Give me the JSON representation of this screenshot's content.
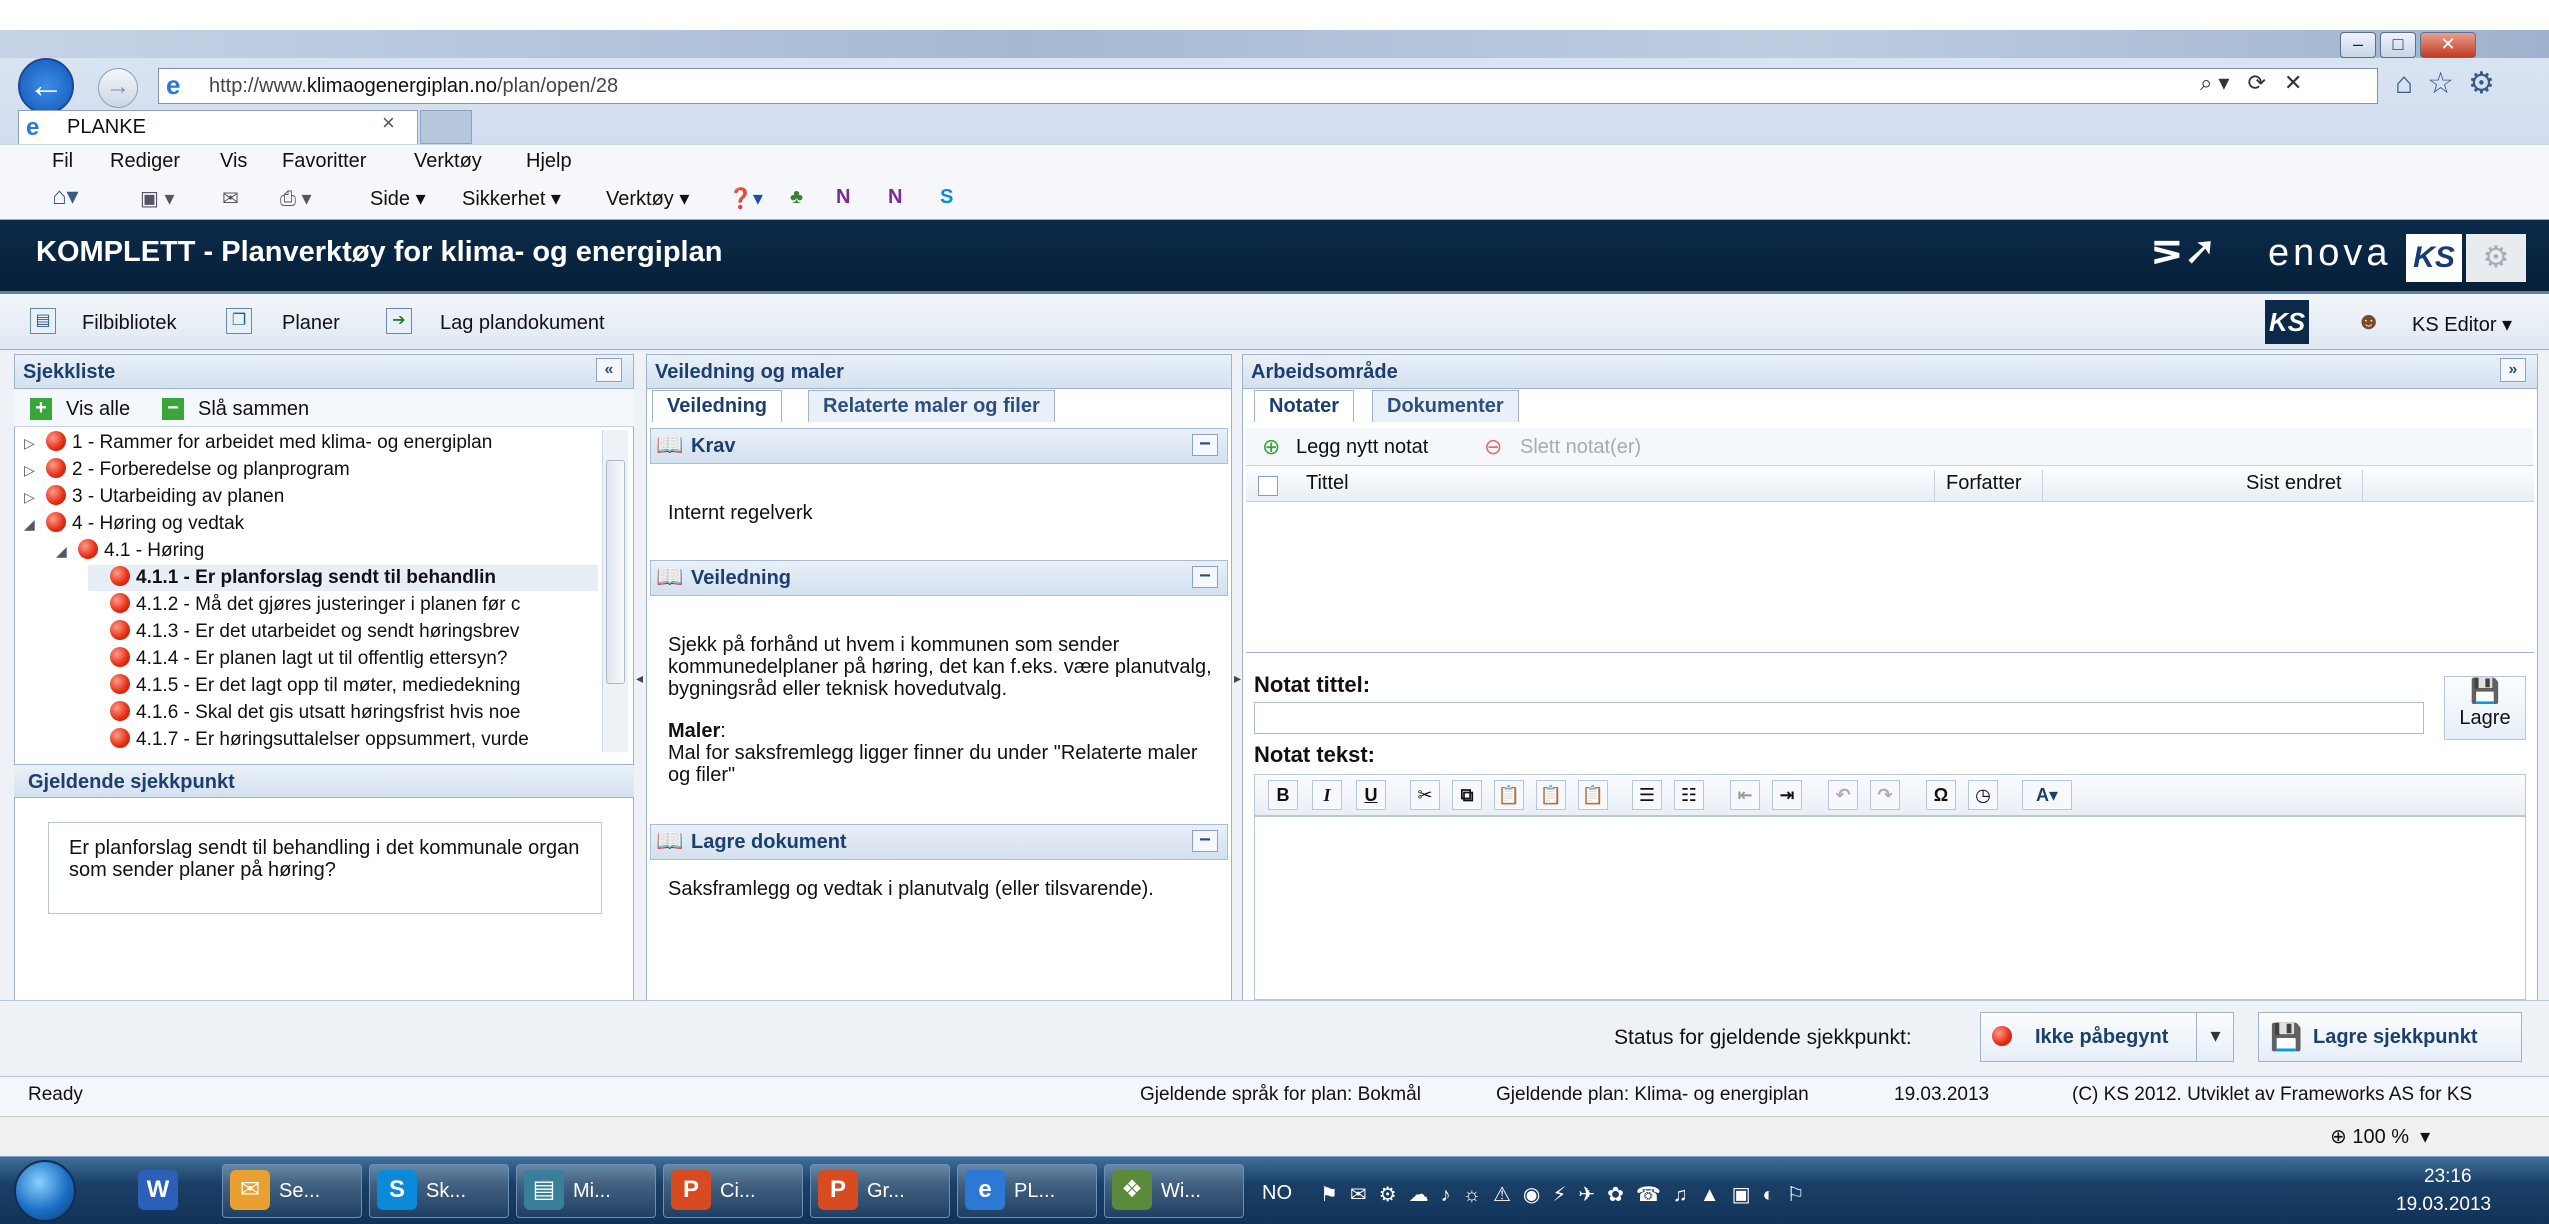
{
  "browser": {
    "url_prefix": "http://www.",
    "url_domain": "klimaogenergiplan.no",
    "url_path": "/plan/open/28",
    "tab_title": "PLANKE",
    "tab_close": "×",
    "menus": [
      "Fil",
      "Rediger",
      "Vis",
      "Favoritter",
      "Verktøy",
      "Hjelp"
    ],
    "commands": [
      "Side ▾",
      "Sikkerhet ▾",
      "Verktøy ▾"
    ],
    "zoom": "100 %"
  },
  "app": {
    "title": "KOMPLETT - Planverktøy for klima- og energiplan",
    "enova": "enova",
    "ks": "KS",
    "toolbar": [
      "Filbibliotek",
      "Planer",
      "Lag plandokument"
    ],
    "user": "KS Editor ▾"
  },
  "checklist": {
    "title": "Sjekkliste",
    "show_all": "Vis alle",
    "merge": "Slå sammen",
    "items": [
      {
        "label": "1 - Rammer for arbeidet med klima- og energiplan",
        "level": 0,
        "toggle": "▷"
      },
      {
        "label": "2 - Forberedelse og planprogram",
        "level": 0,
        "toggle": "▷"
      },
      {
        "label": "3 - Utarbeiding av planen",
        "level": 0,
        "toggle": "▷"
      },
      {
        "label": "4 - Høring og vedtak",
        "level": 0,
        "toggle": "◢"
      },
      {
        "label": "4.1 - Høring",
        "level": 1,
        "toggle": "◢"
      },
      {
        "label": "4.1.1 - Er planforslag sendt til behandlin",
        "level": 2,
        "toggle": "",
        "bold": true
      },
      {
        "label": "4.1.2 - Må det gjøres justeringer i planen før c",
        "level": 2,
        "toggle": ""
      },
      {
        "label": "4.1.3 - Er det utarbeidet og sendt høringsbrev",
        "level": 2,
        "toggle": ""
      },
      {
        "label": "4.1.4 - Er planen lagt ut til offentlig ettersyn?",
        "level": 2,
        "toggle": ""
      },
      {
        "label": "4.1.5 - Er det lagt opp til møter, mediedekning",
        "level": 2,
        "toggle": ""
      },
      {
        "label": "4.1.6 - Skal det gis utsatt høringsfrist hvis noe",
        "level": 2,
        "toggle": ""
      },
      {
        "label": "4.1.7 - Er høringsuttalelser oppsummert, vurde",
        "level": 2,
        "toggle": ""
      }
    ],
    "current_title": "Gjeldende sjekkpunkt",
    "current_text": "Er planforslag sendt til behandling i det kommunale organ som sender planer på høring?"
  },
  "guidance": {
    "title": "Veiledning og maler",
    "tabs": [
      "Veiledning",
      "Relaterte maler og filer"
    ],
    "krav_title": "Krav",
    "krav_text": "Internt regelverk",
    "veil_title": "Veiledning",
    "veil_text": "Sjekk på forhånd ut hvem i kommunen som sender kommunedelplaner på høring, det kan f.eks. være planutvalg, bygningsråd eller teknisk hovedutvalg.",
    "maler_label": "Maler",
    "maler_colon": ":",
    "maler_text": "Mal for saksfremlegg ligger finner du under \"Relaterte maler og filer\"",
    "lagre_title": "Lagre dokument",
    "lagre_text": "Saksframlegg og vedtak i planutvalg (eller tilsvarende)."
  },
  "workspace": {
    "title": "Arbeidsområde",
    "tabs": [
      "Notater",
      "Dokumenter"
    ],
    "new_note": "Legg nytt notat",
    "delete_note": "Slett notat(er)",
    "columns": [
      "Tittel",
      "Forfatter",
      "Sist endret"
    ],
    "note_title_label": "Notat tittel:",
    "note_title_value": "",
    "save": "Lagre",
    "note_text_label": "Notat tekst:"
  },
  "status": {
    "label": "Status for gjeldende sjekkpunkt:",
    "value": "Ikke påbegynt",
    "save_checkpoint": "Lagre sjekkpunkt"
  },
  "footer": {
    "ready": "Ready",
    "language": "Gjeldende språk for plan: Bokmål",
    "plan": "Gjeldende plan: Klima- og energiplan",
    "date": "19.03.2013",
    "copyright": "(C) KS 2012. Utviklet av Frameworks AS for KS"
  },
  "taskbar": {
    "items": [
      "Se...",
      "Sk...",
      "Mi...",
      "Ci...",
      "Gr...",
      "PL...",
      "Wi..."
    ],
    "lang": "NO",
    "time": "23:16",
    "date": "19.03.2013"
  }
}
